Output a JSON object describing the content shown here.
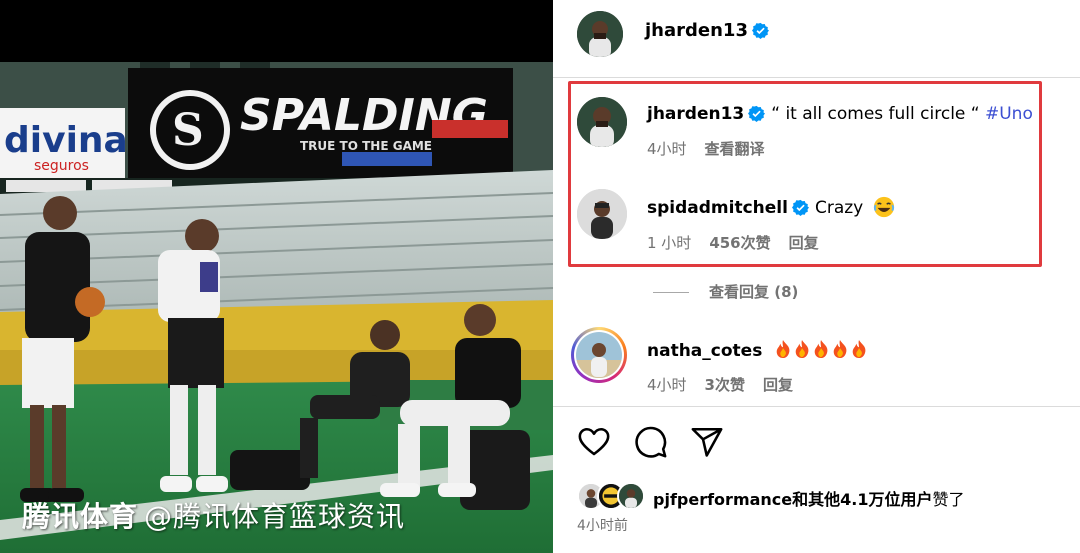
{
  "photo": {
    "banner_brand": "SPALDING",
    "banner_tagline": "TRUE TO THE GAME",
    "left_sign": "divina",
    "left_sign_sub": "seguros",
    "watermark_brand": "腾讯体育",
    "watermark_handle": "@腾讯体育篮球资讯"
  },
  "post": {
    "author": "jharden13",
    "author_verified": true
  },
  "comments": [
    {
      "user": "jharden13",
      "verified": true,
      "text": "“ it all comes full circle “",
      "hashtag": "#Uno",
      "time": "4小时",
      "translate": "查看翻译"
    },
    {
      "user": "spidadmitchell",
      "verified": true,
      "text": "Crazy",
      "emoji": "😂",
      "time": "1 小时",
      "likes": "456次赞",
      "reply": "回复"
    },
    {
      "view_replies": "查看回复 (8)"
    },
    {
      "user": "natha_cotes",
      "fires": 5,
      "time": "4小时",
      "likes": "3次赞",
      "reply": "回复"
    }
  ],
  "actions": {
    "like": "heart-icon",
    "comment": "comment-icon",
    "share": "send-icon"
  },
  "likes": {
    "first_user": "pjfperformance",
    "rest": "和其他4.1万位用户",
    "suffix": "赞了"
  },
  "timestamp": "4小时前",
  "colors": {
    "verified": "#0095f6",
    "highlight": "#e03a3e",
    "hashtag": "#3c4fd2",
    "muted": "#737373"
  }
}
